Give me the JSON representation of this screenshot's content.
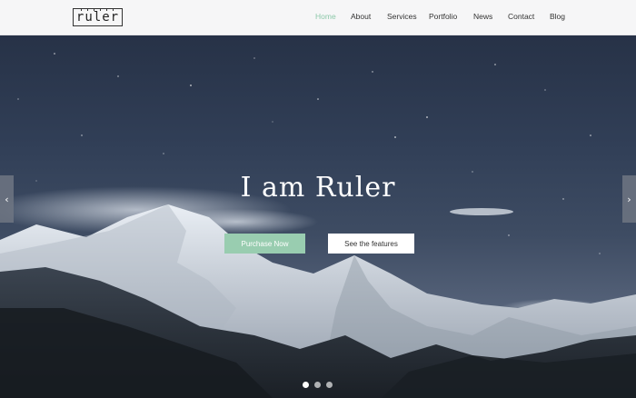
{
  "header": {
    "logo_text": "ruler",
    "nav": [
      {
        "label": "Home",
        "active": true
      },
      {
        "label": "About",
        "active": false
      },
      {
        "label": "Services",
        "active": false
      },
      {
        "label": "Portfolio",
        "active": false
      },
      {
        "label": "News",
        "active": false
      },
      {
        "label": "Contact",
        "active": false
      },
      {
        "label": "Blog",
        "active": false
      }
    ]
  },
  "hero": {
    "title": "I am Ruler",
    "primary_button": "Purchase Now",
    "secondary_button": "See the features",
    "arrow_left_icon": "chevron-left-icon",
    "arrow_right_icon": "chevron-right-icon",
    "slides_count": 3,
    "active_slide": 1
  },
  "colors": {
    "accent": "#8cc8a9",
    "primary_button_bg": "#99cdb0",
    "header_bg": "#f6f6f7"
  }
}
